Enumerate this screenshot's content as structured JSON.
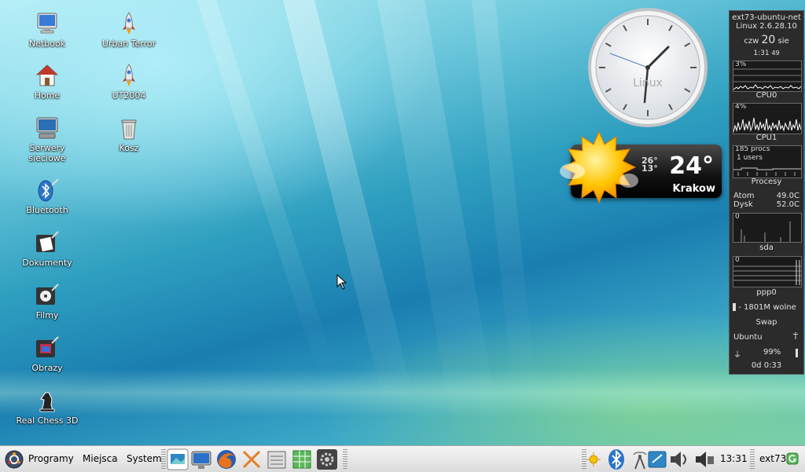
{
  "desktop_icons": [
    {
      "label": "Netbook",
      "icon": "computer-icon"
    },
    {
      "label": "Home",
      "icon": "home-folder-icon"
    },
    {
      "label": "Serwery sieciowe",
      "icon": "network-servers-icon"
    },
    {
      "label": "Bluetooth",
      "icon": "bluetooth-folder-icon"
    },
    {
      "label": "Dokumenty",
      "icon": "documents-folder-icon"
    },
    {
      "label": "Filmy",
      "icon": "movies-folder-icon"
    },
    {
      "label": "Obrazy",
      "icon": "pictures-folder-icon"
    },
    {
      "label": "Real Chess 3D",
      "icon": "chess-knight-icon"
    },
    {
      "label": "Urban Terror",
      "icon": "rocket-icon"
    },
    {
      "label": "UT2004",
      "icon": "rocket-icon"
    },
    {
      "label": "Kosz",
      "icon": "trash-icon"
    }
  ],
  "clock": {
    "brand": "Linux",
    "time": "1:31"
  },
  "weather": {
    "temp": "24°",
    "high": "26°",
    "low": "13°",
    "city": "Krakow",
    "icon": "sun-cloud-icon"
  },
  "conky": {
    "hostname": "ext73-ubuntu-net",
    "kernel": "Linux 2.6.28.10",
    "day": "czw",
    "date_num": "20",
    "month": "sie",
    "time": "1:31",
    "seconds": "49",
    "cpu0_pct": "3%",
    "cpu0_label": "CPU0",
    "cpu1_pct": "4%",
    "cpu1_label": "CPU1",
    "procs": "185 procs",
    "users": "1 users",
    "procs_label": "Procesy",
    "atom_label": "Atom",
    "atom_temp": "49.0C",
    "disk_label": "Dysk",
    "disk_temp": "52.0C",
    "sda_val": "0",
    "sda_label": "sda",
    "ppp_val": "0",
    "ppp_label": "ppp0",
    "mem_free": "- 1801M wolne",
    "swap_label": "Swap",
    "os_label": "Ubuntu",
    "battery": "99%",
    "uptime": "0d 0:33"
  },
  "taskbar": {
    "menu_programy": "Programy",
    "menu_miejsca": "Miejsca",
    "menu_system": "System",
    "clock": "13:31",
    "user": "ext73"
  }
}
